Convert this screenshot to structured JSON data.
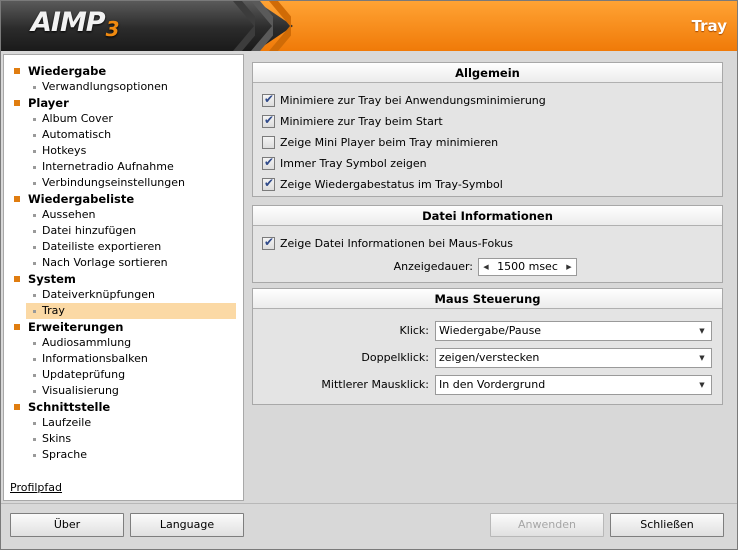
{
  "header": {
    "logo": "AIMP",
    "logo_version": "3",
    "title": "Tray"
  },
  "sidebar": {
    "categories": [
      {
        "label": "Wiedergabe",
        "items": [
          "Verwandlungsoptionen"
        ]
      },
      {
        "label": "Player",
        "items": [
          "Album Cover",
          "Automatisch",
          "Hotkeys",
          "Internetradio Aufnahme",
          "Verbindungseinstellungen"
        ]
      },
      {
        "label": "Wiedergabeliste",
        "items": [
          "Aussehen",
          "Datei hinzufügen",
          "Dateiliste exportieren",
          "Nach Vorlage sortieren"
        ]
      },
      {
        "label": "System",
        "items": [
          "Dateiverknüpfungen",
          "Tray"
        ]
      },
      {
        "label": "Erweiterungen",
        "items": [
          "Audiosammlung",
          "Informationsbalken",
          "Updateprüfung",
          "Visualisierung"
        ]
      },
      {
        "label": "Schnittstelle",
        "items": [
          "Laufzeile",
          "Skins",
          "Sprache"
        ]
      }
    ],
    "selected": "Tray",
    "profile_link": "Profilpfad"
  },
  "allgemein": {
    "title": "Allgemein",
    "options": [
      {
        "label": "Minimiere zur Tray bei Anwendungsminimierung",
        "checked": true
      },
      {
        "label": "Minimiere zur Tray beim Start",
        "checked": true
      },
      {
        "label": "Zeige Mini Player beim Tray minimieren",
        "checked": false
      },
      {
        "label": "Immer Tray Symbol zeigen",
        "checked": true
      },
      {
        "label": "Zeige Wiedergabestatus im Tray-Symbol",
        "checked": true
      }
    ]
  },
  "datei": {
    "title": "Datei Informationen",
    "option": {
      "label": "Zeige Datei Informationen bei Maus-Fokus",
      "checked": true
    },
    "duration_label": "Anzeigedauer:",
    "duration_value": "1500 msec"
  },
  "maus": {
    "title": "Maus Steuerung",
    "rows": [
      {
        "label": "Klick:",
        "value": "Wiedergabe/Pause"
      },
      {
        "label": "Doppelklick:",
        "value": "zeigen/verstecken"
      },
      {
        "label": "Mittlerer Mausklick:",
        "value": "In den Vordergrund"
      }
    ]
  },
  "buttons": {
    "about": "Über",
    "language": "Language",
    "apply": "Anwenden",
    "close": "Schließen"
  }
}
